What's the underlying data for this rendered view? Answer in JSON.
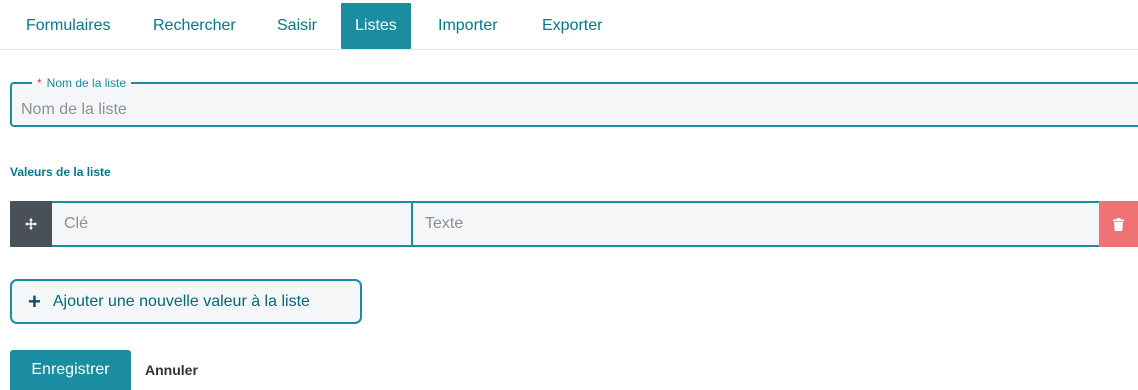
{
  "tabs": [
    {
      "label": "Formulaires",
      "active": false
    },
    {
      "label": "Rechercher",
      "active": false
    },
    {
      "label": "Saisir",
      "active": false
    },
    {
      "label": "Listes",
      "active": true
    },
    {
      "label": "Importer",
      "active": false
    },
    {
      "label": "Exporter",
      "active": false
    }
  ],
  "name_field": {
    "legend": "Nom de la liste",
    "required_marker": "*",
    "placeholder": "Nom de la liste",
    "value": ""
  },
  "values_section": {
    "label": "Valeurs de la liste",
    "rows": [
      {
        "key_placeholder": "Clé",
        "text_placeholder": "Texte",
        "key": "",
        "text": ""
      }
    ]
  },
  "add_button": {
    "icon": "+",
    "label": "Ajouter une nouvelle valeur à la liste"
  },
  "actions": {
    "save_label": "Enregistrer",
    "cancel_label": "Annuler"
  },
  "colors": {
    "accent": "#1a8da0",
    "delete": "#ef7274",
    "handle": "#4a5058"
  },
  "icons": {
    "drag": "move-icon",
    "delete": "trash-icon"
  }
}
